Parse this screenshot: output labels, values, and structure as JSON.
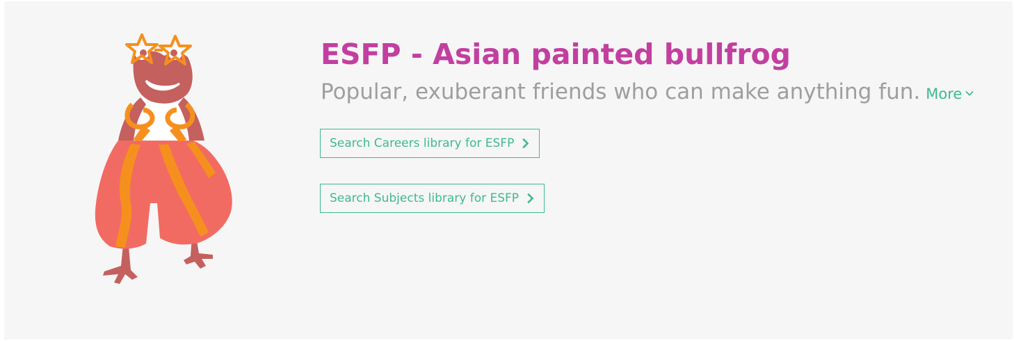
{
  "profile": {
    "title": "ESFP - Asian painted bullfrog",
    "tagline": "Popular, exuberant friends who can make anything fun.",
    "more_label": "More"
  },
  "actions": {
    "careers_label": "Search Careers library for ESFP",
    "subjects_label": "Search Subjects library for ESFP"
  },
  "icons": {
    "mascot": "bullfrog-illustration",
    "more": "chevron-down-icon",
    "button": "chevron-right-icon"
  },
  "colors": {
    "background": "#f6f6f6",
    "title": "#c23fa0",
    "tagline": "#9e9e9e",
    "accent": "#3dba8e",
    "frog_body": "#c4605e",
    "trousers": "#f26b62",
    "stripes": "#f5901e",
    "glasses": "#f5901e"
  }
}
